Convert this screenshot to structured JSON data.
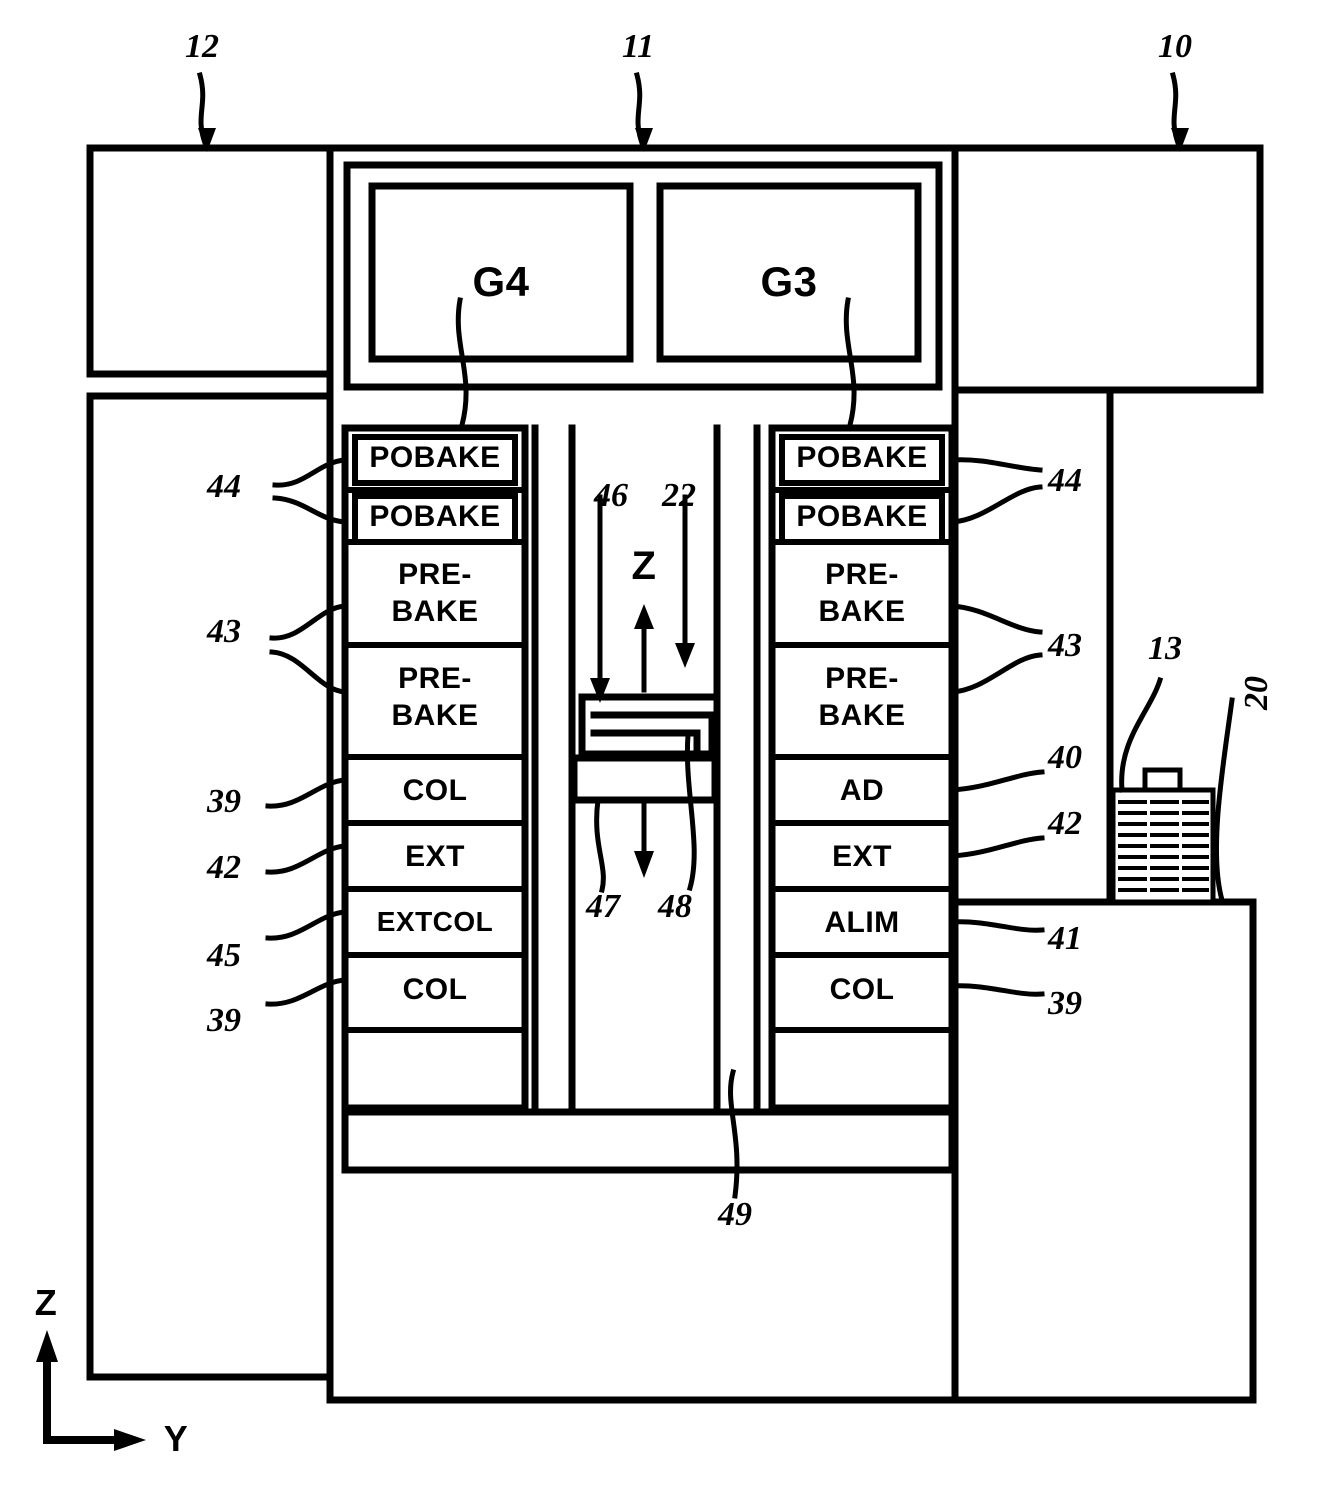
{
  "figure": {
    "type": "patent-diagram",
    "title": "Substrate processing apparatus schematic (side elevation)",
    "axes": {
      "vertical": "Z",
      "horizontal": "Y"
    },
    "transport_direction_label": "Z"
  },
  "group_boxes": [
    {
      "id": "g4",
      "label": "G4"
    },
    {
      "id": "g3",
      "label": "G3"
    }
  ],
  "left_stack": {
    "name": "G4 module stack",
    "modules": [
      {
        "label": "POBAKE",
        "ref": "44",
        "inset": true,
        "lines": 1
      },
      {
        "label": "POBAKE",
        "ref": "44",
        "inset": true,
        "lines": 1
      },
      {
        "label": "PRE-\nBAKE",
        "ref": "43",
        "inset": false,
        "lines": 2
      },
      {
        "label": "PRE-\nBAKE",
        "ref": "43",
        "inset": false,
        "lines": 2
      },
      {
        "label": "COL",
        "ref": "39",
        "inset": false,
        "lines": 1
      },
      {
        "label": "EXT",
        "ref": "42",
        "inset": false,
        "lines": 1
      },
      {
        "label": "EXTCOL",
        "ref": "45",
        "inset": false,
        "lines": 1
      },
      {
        "label": "COL",
        "ref": "39",
        "inset": false,
        "lines": 1
      },
      {
        "label": "",
        "ref": "",
        "inset": false,
        "lines": 1
      }
    ]
  },
  "right_stack": {
    "name": "G3 module stack",
    "modules": [
      {
        "label": "POBAKE",
        "ref": "44",
        "inset": true,
        "lines": 1
      },
      {
        "label": "POBAKE",
        "ref": "44",
        "inset": true,
        "lines": 1
      },
      {
        "label": "PRE-\nBAKE",
        "ref": "43",
        "inset": false,
        "lines": 2
      },
      {
        "label": "PRE-\nBAKE",
        "ref": "43",
        "inset": false,
        "lines": 2
      },
      {
        "label": "AD",
        "ref": "40",
        "inset": false,
        "lines": 1
      },
      {
        "label": "EXT",
        "ref": "42",
        "inset": false,
        "lines": 1
      },
      {
        "label": "ALIM",
        "ref": "41",
        "inset": false,
        "lines": 1
      },
      {
        "label": "COL",
        "ref": "39",
        "inset": false,
        "lines": 1
      },
      {
        "label": "",
        "ref": "",
        "inset": false,
        "lines": 1
      }
    ]
  },
  "left_module_texts": [
    "POBAKE",
    "POBAKE",
    "PRE-",
    "BAKE",
    "PRE-",
    "BAKE",
    "COL",
    "EXT",
    "EXTCOL",
    "COL"
  ],
  "right_module_texts": [
    "POBAKE",
    "POBAKE",
    "PRE-",
    "BAKE",
    "PRE-",
    "BAKE",
    "AD",
    "EXT",
    "ALIM",
    "COL"
  ],
  "reference_numerals": {
    "r10": "10",
    "r11": "11",
    "r12": "12",
    "r13": "13",
    "r20": "20",
    "r22": "22",
    "r46": "46",
    "r47": "47",
    "r48": "48",
    "r49": "49",
    "left_44_a": "44",
    "left_43_a": "43",
    "left_39_a": "39",
    "left_42_a": "42",
    "left_45_a": "45",
    "left_39_b": "39",
    "right_44_a": "44",
    "right_43_a": "43",
    "right_40_a": "40",
    "right_42_a": "42",
    "right_41_a": "41",
    "right_39_a": "39"
  },
  "axes": {
    "z_label": "Z",
    "y_label": "Y"
  },
  "center_lane": {
    "z_arrow_label": "Z",
    "carrier_ref": "13",
    "stage_ref": "20"
  },
  "colors": {
    "line": "#000000",
    "background": "#ffffff"
  }
}
